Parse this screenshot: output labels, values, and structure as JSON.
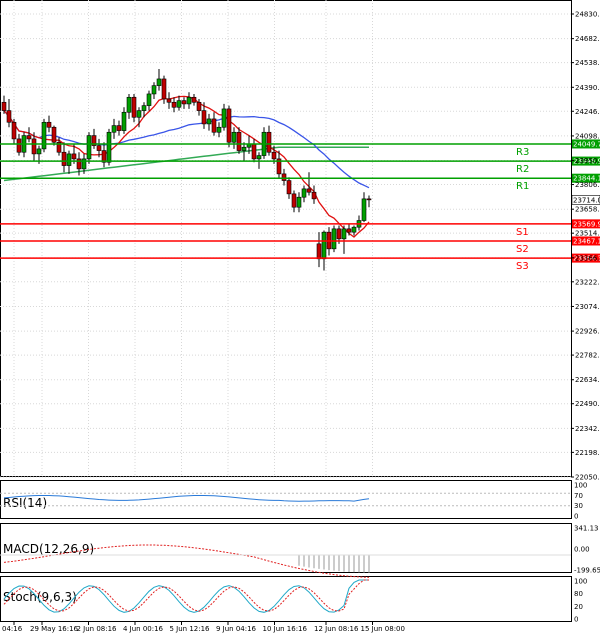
{
  "chart_data": {
    "type": "candlestick",
    "price_axis": {
      "ylim": [
        22050,
        24830
      ],
      "ticks": [
        "24830.0",
        "24682.0",
        "24538.0",
        "24390.0",
        "24246.0",
        "24098.0",
        "23950.0",
        "23806.0",
        "23658.0",
        "23514.0",
        "23366.0",
        "23222.0",
        "23074.0",
        "22926.0",
        "22782.0",
        "22634.0",
        "22490.0",
        "22342.0",
        "22198.0",
        "22050.0"
      ]
    },
    "time_axis": {
      "labels": [
        "04:16",
        "29 May 16:16",
        "2 Jun 08:16",
        "4 Jun 00:16",
        "5 Jun 12:16",
        "9 Jun 04:16",
        "10 Jun 16:16",
        "12 Jun 08:16",
        "15 Jun 08:00"
      ]
    },
    "current_price": "23714.0",
    "levels": [
      {
        "name": "R3",
        "value": 24049.7,
        "label": "24049.7",
        "color": "#00a000"
      },
      {
        "name": "R2",
        "value": 23946.9,
        "label": "23946.9",
        "color": "#00a000"
      },
      {
        "name": "R1",
        "value": 23844.1,
        "label": "23844.1",
        "color": "#00a000"
      },
      {
        "name": "S1",
        "value": 23569.9,
        "label": "23569.9",
        "color": "#ff0000"
      },
      {
        "name": "S2",
        "value": 23467.1,
        "label": "23467.1",
        "color": "#ff0000"
      },
      {
        "name": "S3",
        "value": 23364.3,
        "label": "23364.3",
        "color": "#ff0000"
      }
    ],
    "candles": [
      {
        "o": 24300,
        "h": 24340,
        "l": 24230,
        "c": 24250
      },
      {
        "o": 24250,
        "h": 24320,
        "l": 24150,
        "c": 24180
      },
      {
        "o": 24180,
        "h": 24200,
        "l": 24050,
        "c": 24080
      },
      {
        "o": 24080,
        "h": 24110,
        "l": 23980,
        "c": 24000
      },
      {
        "o": 24000,
        "h": 24120,
        "l": 23970,
        "c": 24100
      },
      {
        "o": 24100,
        "h": 24150,
        "l": 24060,
        "c": 24080
      },
      {
        "o": 24080,
        "h": 24120,
        "l": 23950,
        "c": 23990
      },
      {
        "o": 23990,
        "h": 24040,
        "l": 23930,
        "c": 24020
      },
      {
        "o": 24020,
        "h": 24200,
        "l": 24000,
        "c": 24180
      },
      {
        "o": 24180,
        "h": 24220,
        "l": 24120,
        "c": 24150
      },
      {
        "o": 24150,
        "h": 24160,
        "l": 24040,
        "c": 24060
      },
      {
        "o": 24060,
        "h": 24090,
        "l": 23980,
        "c": 24000
      },
      {
        "o": 24000,
        "h": 24060,
        "l": 23880,
        "c": 23920
      },
      {
        "o": 23920,
        "h": 24010,
        "l": 23870,
        "c": 23990
      },
      {
        "o": 23990,
        "h": 24050,
        "l": 23930,
        "c": 23960
      },
      {
        "o": 23960,
        "h": 24000,
        "l": 23860,
        "c": 23900
      },
      {
        "o": 23900,
        "h": 23990,
        "l": 23870,
        "c": 23960
      },
      {
        "o": 23960,
        "h": 24120,
        "l": 23930,
        "c": 24100
      },
      {
        "o": 24100,
        "h": 24140,
        "l": 24020,
        "c": 24040
      },
      {
        "o": 24040,
        "h": 24080,
        "l": 23970,
        "c": 24010
      },
      {
        "o": 24010,
        "h": 24060,
        "l": 23910,
        "c": 23940
      },
      {
        "o": 23940,
        "h": 24140,
        "l": 23920,
        "c": 24120
      },
      {
        "o": 24120,
        "h": 24200,
        "l": 24080,
        "c": 24160
      },
      {
        "o": 24160,
        "h": 24190,
        "l": 24100,
        "c": 24130
      },
      {
        "o": 24130,
        "h": 24270,
        "l": 24110,
        "c": 24240
      },
      {
        "o": 24240,
        "h": 24350,
        "l": 24200,
        "c": 24330
      },
      {
        "o": 24330,
        "h": 24350,
        "l": 24180,
        "c": 24210
      },
      {
        "o": 24210,
        "h": 24270,
        "l": 24150,
        "c": 24250
      },
      {
        "o": 24250,
        "h": 24300,
        "l": 24210,
        "c": 24280
      },
      {
        "o": 24280,
        "h": 24370,
        "l": 24250,
        "c": 24350
      },
      {
        "o": 24350,
        "h": 24420,
        "l": 24320,
        "c": 24400
      },
      {
        "o": 24400,
        "h": 24500,
        "l": 24370,
        "c": 24440
      },
      {
        "o": 24440,
        "h": 24460,
        "l": 24290,
        "c": 24320
      },
      {
        "o": 24320,
        "h": 24360,
        "l": 24260,
        "c": 24300
      },
      {
        "o": 24300,
        "h": 24330,
        "l": 24240,
        "c": 24270
      },
      {
        "o": 24270,
        "h": 24340,
        "l": 24250,
        "c": 24310
      },
      {
        "o": 24310,
        "h": 24330,
        "l": 24260,
        "c": 24290
      },
      {
        "o": 24290,
        "h": 24360,
        "l": 24260,
        "c": 24330
      },
      {
        "o": 24330,
        "h": 24350,
        "l": 24280,
        "c": 24300
      },
      {
        "o": 24300,
        "h": 24320,
        "l": 24220,
        "c": 24250
      },
      {
        "o": 24250,
        "h": 24300,
        "l": 24140,
        "c": 24170
      },
      {
        "o": 24170,
        "h": 24230,
        "l": 24130,
        "c": 24200
      },
      {
        "o": 24200,
        "h": 24240,
        "l": 24100,
        "c": 24120
      },
      {
        "o": 24120,
        "h": 24180,
        "l": 24090,
        "c": 24150
      },
      {
        "o": 24150,
        "h": 24290,
        "l": 24130,
        "c": 24260
      },
      {
        "o": 24260,
        "h": 24280,
        "l": 24030,
        "c": 24060
      },
      {
        "o": 24060,
        "h": 24150,
        "l": 24020,
        "c": 24120
      },
      {
        "o": 24120,
        "h": 24150,
        "l": 23990,
        "c": 24010
      },
      {
        "o": 24010,
        "h": 24060,
        "l": 23950,
        "c": 24030
      },
      {
        "o": 24030,
        "h": 24100,
        "l": 23990,
        "c": 24050
      },
      {
        "o": 24050,
        "h": 24080,
        "l": 23940,
        "c": 23960
      },
      {
        "o": 23960,
        "h": 24000,
        "l": 23900,
        "c": 23980
      },
      {
        "o": 23980,
        "h": 24150,
        "l": 23960,
        "c": 24120
      },
      {
        "o": 24120,
        "h": 24160,
        "l": 23980,
        "c": 24000
      },
      {
        "o": 24000,
        "h": 24040,
        "l": 23930,
        "c": 23960
      },
      {
        "o": 23960,
        "h": 24010,
        "l": 23840,
        "c": 23870
      },
      {
        "o": 23870,
        "h": 23900,
        "l": 23800,
        "c": 23830
      },
      {
        "o": 23830,
        "h": 23850,
        "l": 23720,
        "c": 23750
      },
      {
        "o": 23750,
        "h": 23770,
        "l": 23640,
        "c": 23670
      },
      {
        "o": 23670,
        "h": 23760,
        "l": 23640,
        "c": 23730
      },
      {
        "o": 23730,
        "h": 23800,
        "l": 23700,
        "c": 23780
      },
      {
        "o": 23780,
        "h": 23880,
        "l": 23740,
        "c": 23760
      },
      {
        "o": 23760,
        "h": 23800,
        "l": 23690,
        "c": 23720
      },
      {
        "o": 23450,
        "h": 23520,
        "l": 23310,
        "c": 23360
      },
      {
        "o": 23360,
        "h": 23530,
        "l": 23290,
        "c": 23520
      },
      {
        "o": 23520,
        "h": 23550,
        "l": 23380,
        "c": 23420
      },
      {
        "o": 23420,
        "h": 23560,
        "l": 23400,
        "c": 23540
      },
      {
        "o": 23540,
        "h": 23560,
        "l": 23450,
        "c": 23480
      },
      {
        "o": 23480,
        "h": 23560,
        "l": 23390,
        "c": 23540
      },
      {
        "o": 23540,
        "h": 23570,
        "l": 23500,
        "c": 23520
      },
      {
        "o": 23520,
        "h": 23560,
        "l": 23500,
        "c": 23550
      },
      {
        "o": 23550,
        "h": 23620,
        "l": 23530,
        "c": 23590
      },
      {
        "o": 23590,
        "h": 23760,
        "l": 23580,
        "c": 23720
      },
      {
        "o": 23720,
        "h": 23740,
        "l": 23670,
        "c": 23714
      }
    ],
    "indicators": [
      {
        "name": "RSI(14)",
        "axis_labels": [
          "100",
          "70",
          "30",
          "0"
        ]
      },
      {
        "name": "MACD(12,26,9)",
        "axis_labels": [
          "341.13",
          "0.00",
          "-199.65"
        ]
      },
      {
        "name": "Stoch(9,6,3)",
        "axis_labels": [
          "100",
          "80",
          "20",
          "0"
        ]
      }
    ]
  }
}
